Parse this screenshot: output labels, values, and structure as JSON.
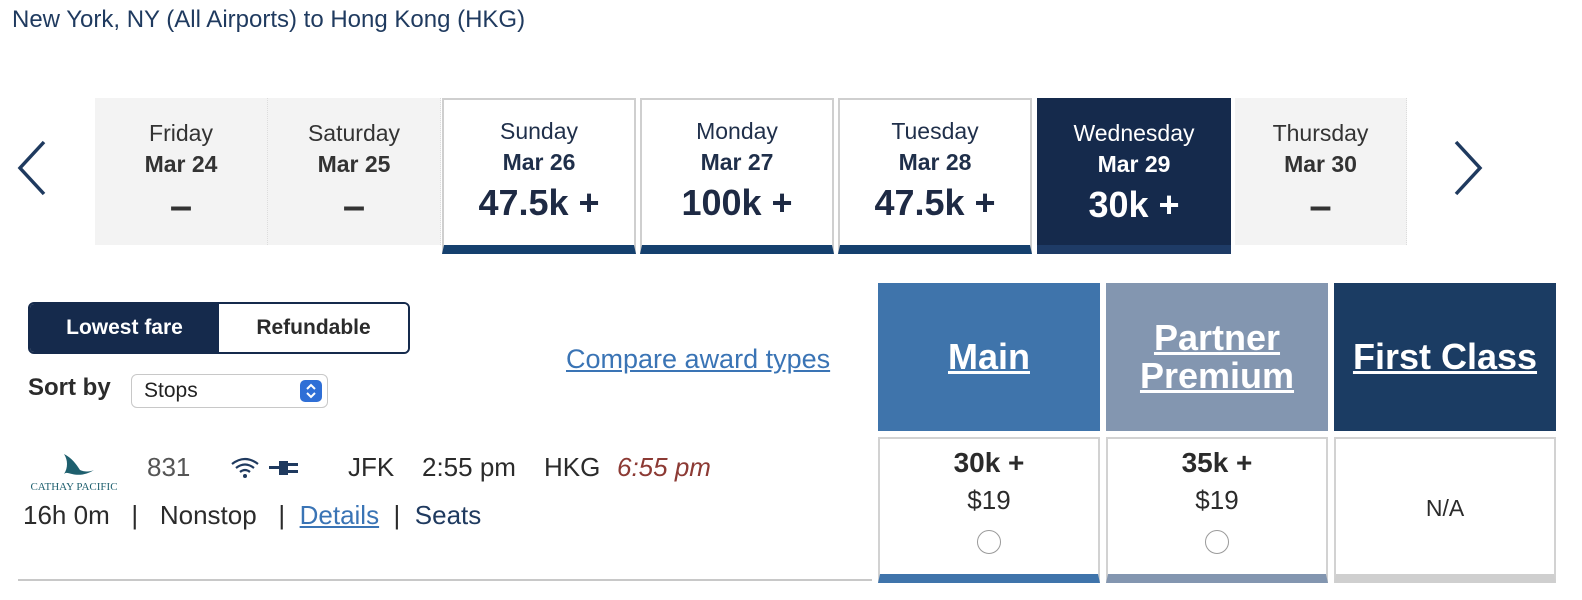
{
  "route": {
    "title": "New York, NY (All Airports) to Hong Kong (HKG)"
  },
  "date_nav": {
    "prev_icon": "chevron-left-icon",
    "next_icon": "chevron-right-icon",
    "days": [
      {
        "day": "Friday",
        "date": "Mar 24",
        "price": "–",
        "state": "empty"
      },
      {
        "day": "Saturday",
        "date": "Mar 25",
        "price": "–",
        "state": "empty"
      },
      {
        "day": "Sunday",
        "date": "Mar 26",
        "price": "47.5k +",
        "state": "priced"
      },
      {
        "day": "Monday",
        "date": "Mar 27",
        "price": "100k +",
        "state": "priced"
      },
      {
        "day": "Tuesday",
        "date": "Mar 28",
        "price": "47.5k +",
        "state": "priced"
      },
      {
        "day": "Wednesday",
        "date": "Mar 29",
        "price": "30k +",
        "state": "selected"
      },
      {
        "day": "Thursday",
        "date": "Mar 30",
        "price": "–",
        "state": "empty"
      }
    ]
  },
  "fare_toggle": {
    "lowest": "Lowest fare",
    "refundable": "Refundable",
    "active": "lowest"
  },
  "sort": {
    "label": "Sort by",
    "value": "Stops"
  },
  "compare_link": "Compare award types",
  "cabins": {
    "main": "Main",
    "partner_line1": "Partner",
    "partner_line2": "Premium",
    "first": "First Class"
  },
  "flight": {
    "airline_logo": "CATHAY PACIFIC",
    "number": "831",
    "amenities": [
      "wifi-icon",
      "power-outlet-icon"
    ],
    "dep_airport": "JFK",
    "dep_time": "2:55 pm",
    "arr_airport": "HKG",
    "arr_time": "6:55 pm",
    "duration": "16h 0m",
    "stops": "Nonstop",
    "details_link": "Details",
    "seats_link": "Seats",
    "fares": {
      "main": {
        "points": "30k +",
        "cash": "$19"
      },
      "partner": {
        "points": "35k +",
        "cash": "$19"
      },
      "first": {
        "na": "N/A"
      }
    }
  },
  "colors": {
    "navy": "#152a4c",
    "main_blue": "#3f74ab",
    "partner_gray_blue": "#8396b0",
    "first_navy": "#1b3c63",
    "link_blue": "#3a74b5",
    "arrival_red": "#8c3a34"
  }
}
